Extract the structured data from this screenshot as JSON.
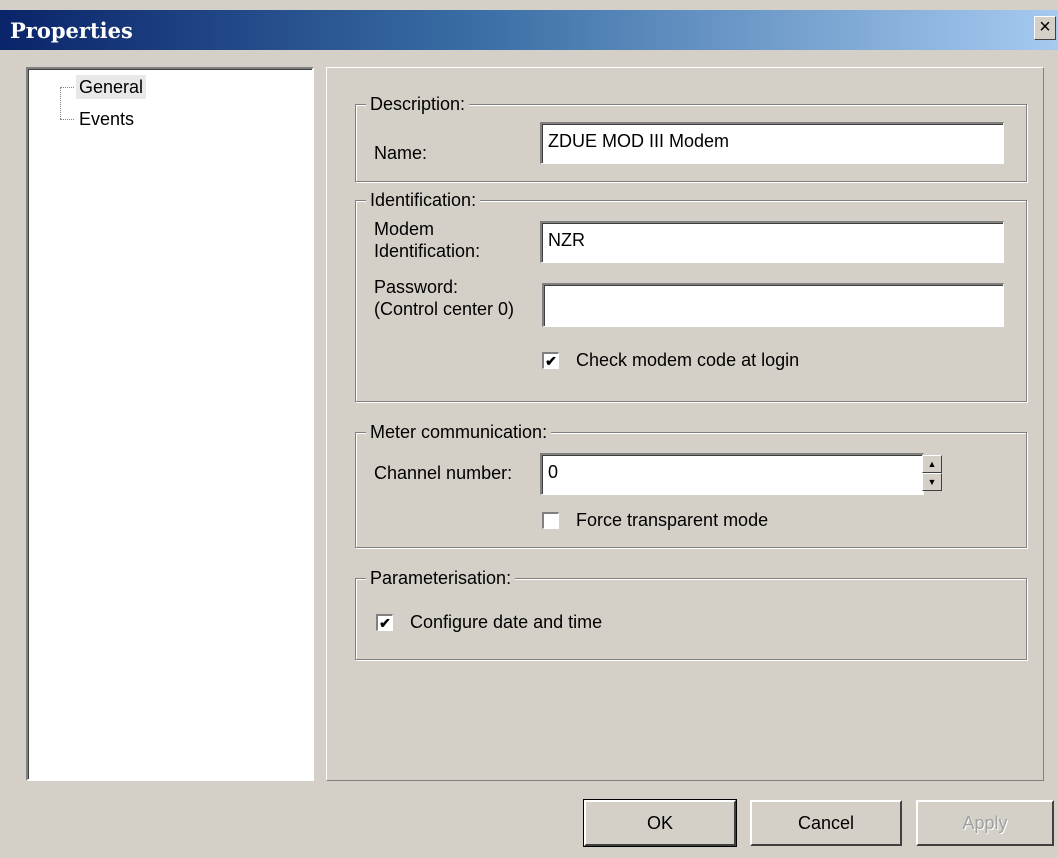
{
  "window": {
    "title": "Properties",
    "close_glyph": "×"
  },
  "tree": {
    "items": [
      {
        "label": "General",
        "selected": true
      },
      {
        "label": "Events",
        "selected": false
      }
    ]
  },
  "description": {
    "group_label": "Description:",
    "name_label": "Name:",
    "name_value": "ZDUE MOD III Modem"
  },
  "identification": {
    "group_label": "Identification:",
    "modem_id_label_1": "Modem",
    "modem_id_label_2": "Identification:",
    "modem_id_value": "NZR",
    "password_label_1": "Password:",
    "password_label_2": "(Control center 0)",
    "password_value": "",
    "check_code_label": "Check modem code at login",
    "check_code_checked": true
  },
  "meter": {
    "group_label": "Meter communication:",
    "channel_label": "Channel number:",
    "channel_value": "0",
    "transparent_label": "Force transparent mode",
    "transparent_checked": false
  },
  "parameterisation": {
    "group_label": "Parameterisation:",
    "date_time_label": "Configure date and time",
    "date_time_checked": true
  },
  "buttons": {
    "ok": "OK",
    "cancel": "Cancel",
    "apply": "Apply"
  },
  "icons": {
    "close": "close-icon",
    "spin_up": "spin-up-icon",
    "spin_down": "spin-down-icon",
    "check": "checkmark-icon"
  }
}
